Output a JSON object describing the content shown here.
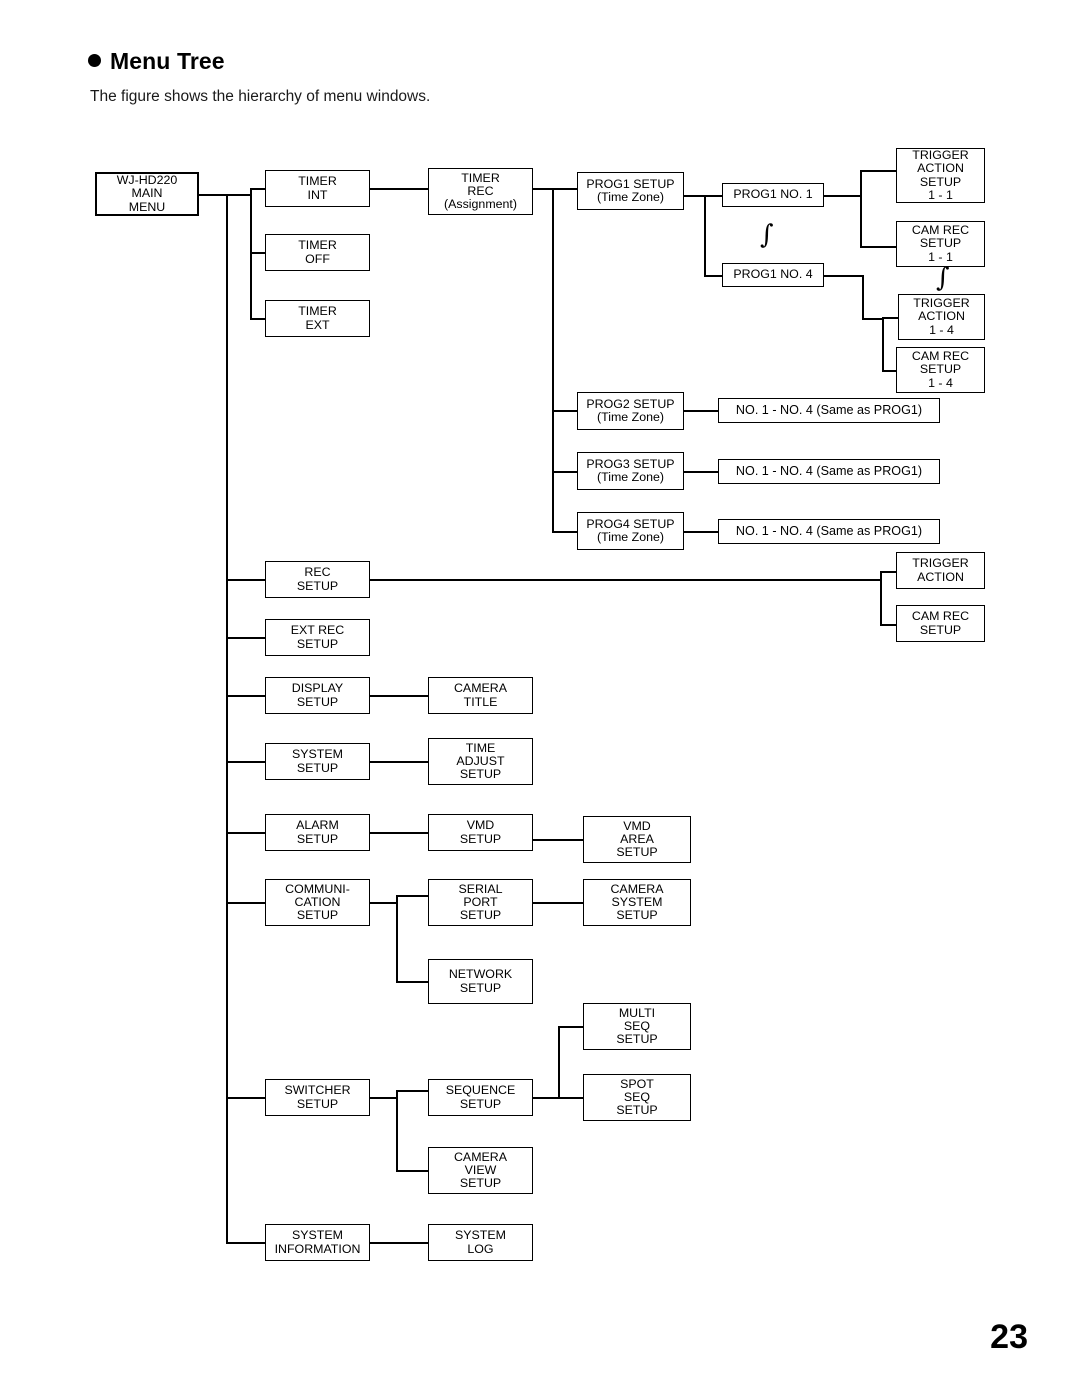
{
  "header": {
    "title": "Menu Tree",
    "subtitle": "The figure shows the hierarchy of menu windows.",
    "bullet_icon": "filled-circle-bullet"
  },
  "footer": {
    "page_number": "23"
  },
  "diagram": {
    "type": "tree",
    "root": {
      "lines": [
        "WJ-HD220",
        "MAIN",
        "MENU"
      ]
    },
    "nodes": [
      {
        "id": "timer-int",
        "lines": [
          "TIMER",
          "INT"
        ]
      },
      {
        "id": "timer-off",
        "lines": [
          "TIMER",
          "OFF"
        ]
      },
      {
        "id": "timer-ext",
        "lines": [
          "TIMER",
          "EXT"
        ]
      },
      {
        "id": "timer-rec",
        "lines": [
          "TIMER",
          "REC",
          "(Assignment)"
        ]
      },
      {
        "id": "prog1-setup",
        "lines": [
          "PROG1 SETUP",
          "(Time Zone)"
        ]
      },
      {
        "id": "prog1-no1",
        "lines": [
          "PROG1 NO. 1"
        ]
      },
      {
        "id": "prog1-no4",
        "lines": [
          "PROG1 NO. 4"
        ]
      },
      {
        "id": "trigger-action-setup-1-1",
        "lines": [
          "TRIGGER",
          "ACTION",
          "SETUP",
          "1 - 1"
        ]
      },
      {
        "id": "cam-rec-setup-1-1",
        "lines": [
          "CAM REC",
          "SETUP",
          "1 - 1"
        ]
      },
      {
        "id": "trigger-action-1-4",
        "lines": [
          "TRIGGER",
          "ACTION",
          "1 - 4"
        ]
      },
      {
        "id": "cam-rec-setup-1-4",
        "lines": [
          "CAM REC",
          "SETUP",
          "1 - 4"
        ]
      },
      {
        "id": "prog2-setup",
        "lines": [
          "PROG2 SETUP",
          "(Time Zone)"
        ]
      },
      {
        "id": "prog2-no",
        "lines": [
          "NO. 1 - NO. 4 (Same as PROG1)"
        ]
      },
      {
        "id": "prog3-setup",
        "lines": [
          "PROG3 SETUP",
          "(Time Zone)"
        ]
      },
      {
        "id": "prog3-no",
        "lines": [
          "NO. 1 - NO. 4 (Same as PROG1)"
        ]
      },
      {
        "id": "prog4-setup",
        "lines": [
          "PROG4 SETUP",
          "(Time Zone)"
        ]
      },
      {
        "id": "prog4-no",
        "lines": [
          "NO. 1 - NO. 4 (Same as PROG1)"
        ]
      },
      {
        "id": "rec-setup",
        "lines": [
          "REC",
          "SETUP"
        ]
      },
      {
        "id": "trigger-action",
        "lines": [
          "TRIGGER",
          "ACTION"
        ]
      },
      {
        "id": "cam-rec-setup",
        "lines": [
          "CAM REC",
          "SETUP"
        ]
      },
      {
        "id": "ext-rec-setup",
        "lines": [
          "EXT REC",
          "SETUP"
        ]
      },
      {
        "id": "display-setup",
        "lines": [
          "DISPLAY",
          "SETUP"
        ]
      },
      {
        "id": "camera-title",
        "lines": [
          "CAMERA",
          "TITLE"
        ]
      },
      {
        "id": "system-setup",
        "lines": [
          "SYSTEM",
          "SETUP"
        ]
      },
      {
        "id": "time-adjust-setup",
        "lines": [
          "TIME",
          "ADJUST",
          "SETUP"
        ]
      },
      {
        "id": "alarm-setup",
        "lines": [
          "ALARM",
          "SETUP"
        ]
      },
      {
        "id": "vmd-setup",
        "lines": [
          "VMD",
          "SETUP"
        ]
      },
      {
        "id": "vmd-area-setup",
        "lines": [
          "VMD",
          "AREA",
          "SETUP"
        ]
      },
      {
        "id": "communication-setup",
        "lines": [
          "COMMUNI-",
          "CATION",
          "SETUP"
        ]
      },
      {
        "id": "serial-port-setup",
        "lines": [
          "SERIAL",
          "PORT",
          "SETUP"
        ]
      },
      {
        "id": "camera-system-setup",
        "lines": [
          "CAMERA",
          "SYSTEM",
          "SETUP"
        ]
      },
      {
        "id": "network-setup",
        "lines": [
          "NETWORK",
          "SETUP"
        ]
      },
      {
        "id": "switcher-setup",
        "lines": [
          "SWITCHER",
          "SETUP"
        ]
      },
      {
        "id": "sequence-setup",
        "lines": [
          "SEQUENCE",
          "SETUP"
        ]
      },
      {
        "id": "multi-seq-setup",
        "lines": [
          "MULTI",
          "SEQ",
          "SETUP"
        ]
      },
      {
        "id": "spot-seq-setup",
        "lines": [
          "SPOT",
          "SEQ",
          "SETUP"
        ]
      },
      {
        "id": "camera-view-setup",
        "lines": [
          "CAMERA",
          "VIEW",
          "SETUP"
        ]
      },
      {
        "id": "system-information",
        "lines": [
          "SYSTEM",
          "INFORMATION"
        ]
      },
      {
        "id": "system-log",
        "lines": [
          "SYSTEM",
          "LOG"
        ]
      }
    ],
    "continuation_marks": [
      "∫",
      "∫"
    ]
  }
}
